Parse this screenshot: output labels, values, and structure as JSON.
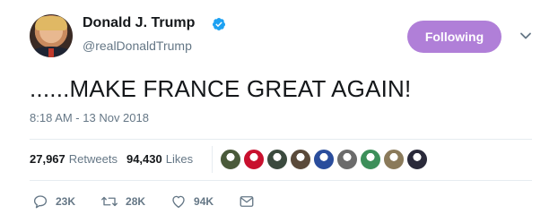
{
  "author": {
    "name": "Donald J. Trump",
    "handle": "@realDonaldTrump"
  },
  "follow_button": {
    "label": "Following"
  },
  "tweet": {
    "text": "......MAKE FRANCE GREAT AGAIN!",
    "timestamp": "8:18 AM - 13 Nov 2018"
  },
  "stats": {
    "retweets_count": "27,967",
    "retweets_label": "Retweets",
    "likes_count": "94,430",
    "likes_label": "Likes"
  },
  "liker_avatars": [
    {
      "name": "liker-avatar-1",
      "color": "#4a5a3a"
    },
    {
      "name": "liker-avatar-2",
      "color": "#c8102e"
    },
    {
      "name": "liker-avatar-3",
      "color": "#3b4a3e"
    },
    {
      "name": "liker-avatar-4",
      "color": "#5a4a3a"
    },
    {
      "name": "liker-avatar-5",
      "color": "#2a4d9c"
    },
    {
      "name": "liker-avatar-6",
      "color": "#6b6b6b"
    },
    {
      "name": "liker-avatar-7",
      "color": "#3d8f5a"
    },
    {
      "name": "liker-avatar-8",
      "color": "#8a7a5a"
    },
    {
      "name": "liker-avatar-9",
      "color": "#2a2a3a"
    }
  ],
  "actions": {
    "reply_count": "23K",
    "retweet_count": "28K",
    "like_count": "94K"
  },
  "colors": {
    "follow_button_bg": "#b07fd8",
    "verified_badge": "#1da1f2",
    "secondary_text": "#657786"
  },
  "icons": [
    "verified-badge-icon",
    "chevron-down-icon",
    "reply-icon",
    "retweet-icon",
    "like-icon",
    "direct-message-icon"
  ]
}
